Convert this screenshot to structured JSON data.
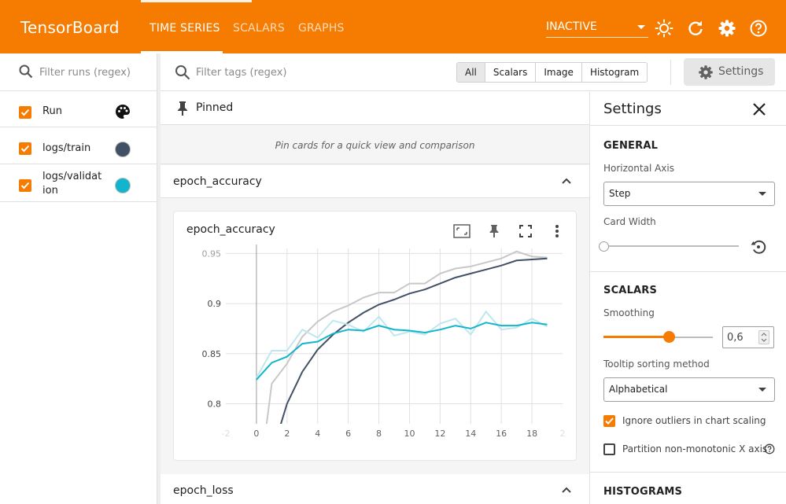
{
  "app": {
    "title": "TensorBoard",
    "accent": "#f57c00",
    "tabs": [
      {
        "label": "TIME SERIES",
        "active": true
      },
      {
        "label": "SCALARS",
        "active": false
      },
      {
        "label": "GRAPHS",
        "active": false
      }
    ],
    "plugin_select": "INACTIVE",
    "icons": [
      "brightness-icon",
      "refresh-icon",
      "gear-icon",
      "help-icon"
    ]
  },
  "sidebar": {
    "filter_placeholder": "Filter runs (regex)",
    "header": {
      "label": "Run",
      "checked": true,
      "icon": "palette-icon"
    },
    "runs": [
      {
        "label_line1": "logs/train",
        "label_line2": "",
        "checked": true,
        "color": "#425066"
      },
      {
        "label_line1": "logs/validat",
        "label_line2": "ion",
        "checked": true,
        "color": "#12b5cb"
      }
    ]
  },
  "toolbar": {
    "filter_placeholder": "Filter tags (regex)",
    "filters": [
      {
        "label": "All",
        "active": true
      },
      {
        "label": "Scalars",
        "active": false
      },
      {
        "label": "Image",
        "active": false
      },
      {
        "label": "Histogram",
        "active": false
      }
    ],
    "settings_label": "Settings"
  },
  "main": {
    "pinned_label": "Pinned",
    "pinned_empty": "Pin cards for a quick view and comparison",
    "groups": [
      {
        "label": "epoch_accuracy"
      },
      {
        "label": "epoch_loss"
      }
    ],
    "card": {
      "title": "epoch_accuracy"
    }
  },
  "chart_data": {
    "type": "line",
    "title": "epoch_accuracy",
    "xlabel": "",
    "ylabel": "",
    "xlim": [
      -2,
      20
    ],
    "ylim": [
      0.78,
      0.955
    ],
    "x_ticks": [
      "-2",
      "0",
      "2",
      "4",
      "6",
      "8",
      "10",
      "12",
      "14",
      "16",
      "18",
      "2"
    ],
    "y_ticks": [
      "0.8",
      "0.85",
      "0.9",
      "0.95"
    ],
    "grid": true,
    "series": [
      {
        "name": "logs/train",
        "color": "#425066",
        "raw_color": "#c8c8c8",
        "x": [
          0,
          1,
          2,
          3,
          4,
          5,
          6,
          7,
          8,
          9,
          10,
          11,
          12,
          13,
          14,
          15,
          16,
          17,
          18,
          19
        ],
        "raw": [
          0.7,
          0.82,
          0.84,
          0.867,
          0.882,
          0.892,
          0.898,
          0.906,
          0.911,
          0.911,
          0.92,
          0.92,
          0.93,
          0.935,
          0.937,
          0.941,
          0.945,
          0.952,
          0.947,
          0.946
        ],
        "smoothed": [
          0.7,
          0.75,
          0.8,
          0.832,
          0.854,
          0.869,
          0.881,
          0.891,
          0.899,
          0.904,
          0.91,
          0.914,
          0.92,
          0.926,
          0.93,
          0.934,
          0.938,
          0.943,
          0.944,
          0.945
        ]
      },
      {
        "name": "logs/validation",
        "color": "#12b5cb",
        "raw_color": "#bfe8ee",
        "x": [
          0,
          1,
          2,
          3,
          4,
          5,
          6,
          7,
          8,
          9,
          10,
          11,
          12,
          13,
          14,
          15,
          16,
          17,
          18,
          19
        ],
        "raw": [
          0.826,
          0.853,
          0.853,
          0.874,
          0.866,
          0.883,
          0.879,
          0.872,
          0.887,
          0.868,
          0.872,
          0.869,
          0.88,
          0.885,
          0.869,
          0.892,
          0.874,
          0.876,
          0.885,
          0.877
        ],
        "smoothed": [
          0.824,
          0.841,
          0.847,
          0.86,
          0.862,
          0.87,
          0.874,
          0.873,
          0.878,
          0.874,
          0.873,
          0.871,
          0.874,
          0.878,
          0.875,
          0.881,
          0.878,
          0.878,
          0.881,
          0.879
        ]
      }
    ]
  },
  "settings": {
    "title": "Settings",
    "general": {
      "section": "GENERAL",
      "horizontal_axis_label": "Horizontal Axis",
      "horizontal_axis_value": "Step",
      "card_width_label": "Card Width",
      "card_width_fraction": 0.0
    },
    "scalars": {
      "section": "SCALARS",
      "smoothing_label": "Smoothing",
      "smoothing_value": "0,6",
      "smoothing_fraction": 0.6,
      "tooltip_label": "Tooltip sorting method",
      "tooltip_value": "Alphabetical",
      "ignore_outliers_label": "Ignore outliers in chart scaling",
      "ignore_outliers_checked": true,
      "partition_label": "Partition non-monotonic X axis",
      "partition_checked": false
    },
    "histograms": {
      "section": "HISTOGRAMS"
    }
  }
}
